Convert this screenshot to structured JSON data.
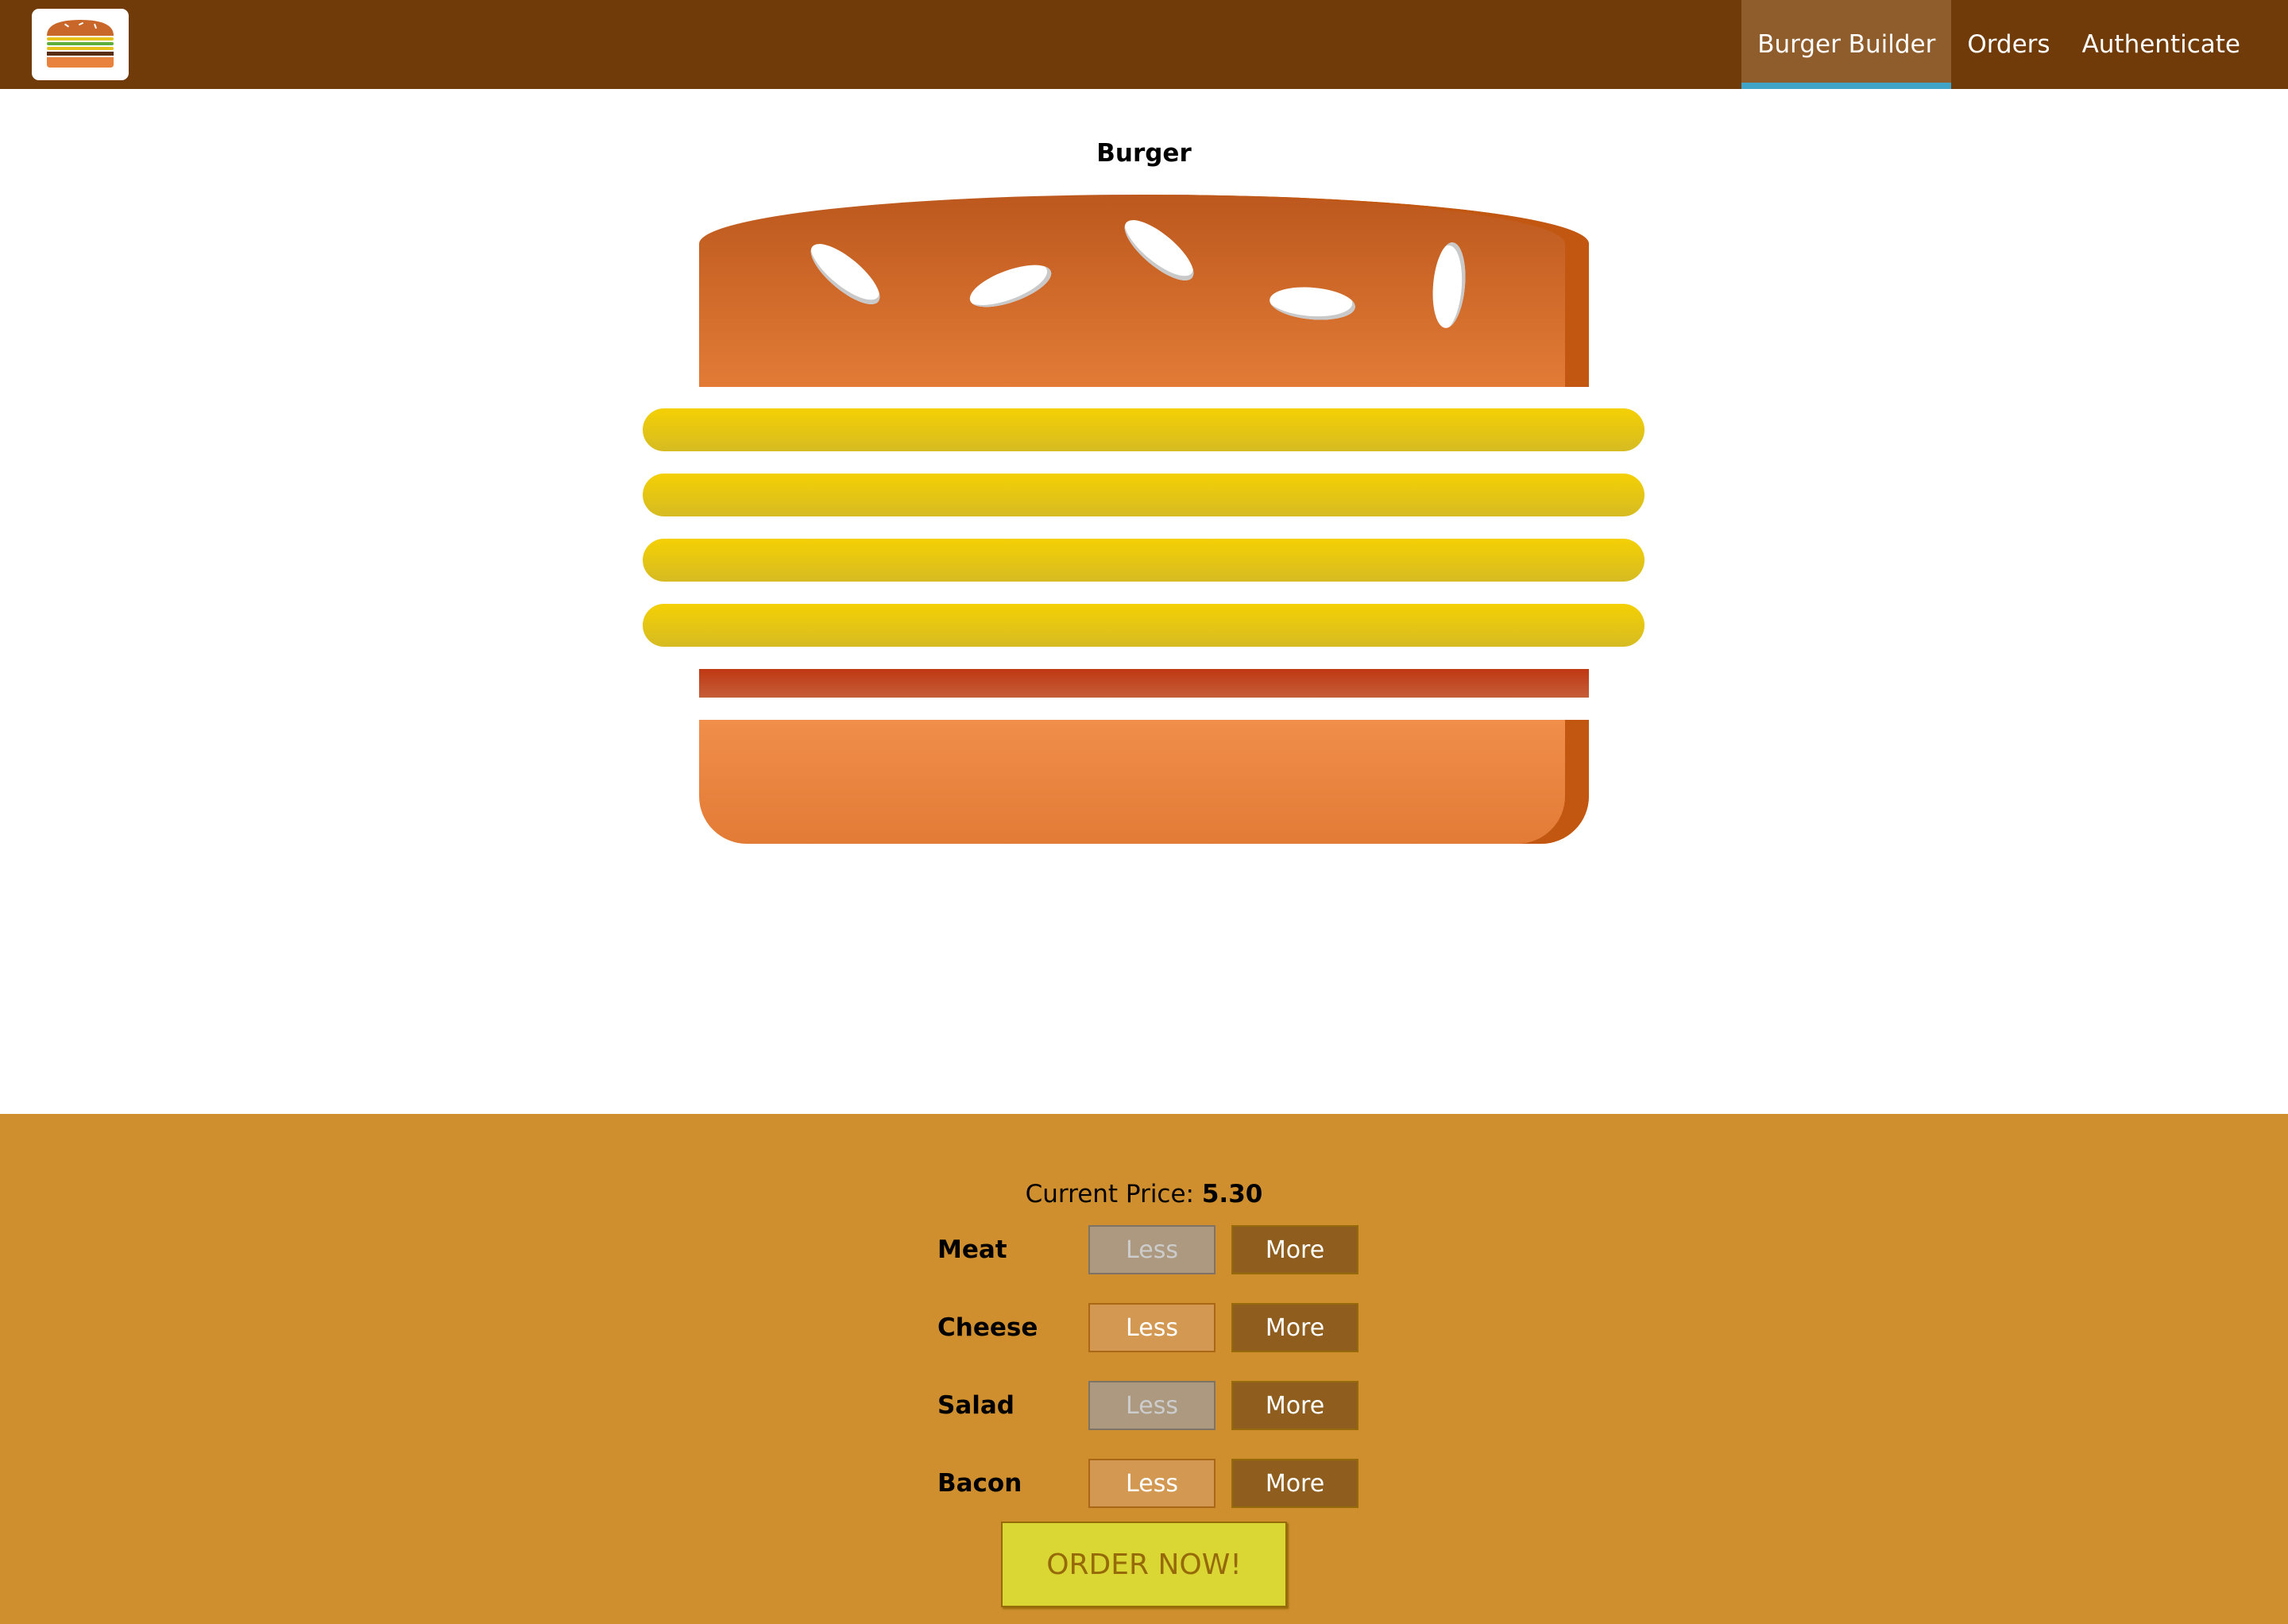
{
  "nav": {
    "items": [
      {
        "label": "Burger Builder",
        "active": true
      },
      {
        "label": "Orders",
        "active": false
      },
      {
        "label": "Authenticate",
        "active": false
      }
    ]
  },
  "burger": {
    "title": "Burger",
    "ingredients": {
      "salad": 0,
      "bacon": 0,
      "cheese": 4,
      "meat": 1
    }
  },
  "controls": {
    "price_label": "Current Price:",
    "price_value": "5.30",
    "rows": [
      {
        "label": "Meat",
        "less": "Less",
        "more": "More",
        "less_disabled": true
      },
      {
        "label": "Cheese",
        "less": "Less",
        "more": "More",
        "less_disabled": false
      },
      {
        "label": "Salad",
        "less": "Less",
        "more": "More",
        "less_disabled": true
      },
      {
        "label": "Bacon",
        "less": "Less",
        "more": "More",
        "less_disabled": false
      }
    ],
    "order_button": "ORDER NOW!"
  },
  "colors": {
    "toolbar": "#703B09",
    "active_nav": "#8F5C2C",
    "active_underline": "#40A4C8",
    "controls_bg": "#CF8F2E",
    "order_button": "#DAD735"
  },
  "icons": {
    "logo": "burger-logo-icon"
  }
}
